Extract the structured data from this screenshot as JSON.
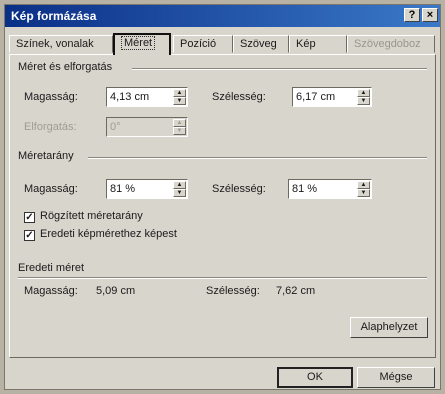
{
  "window": {
    "title": "Kép formázása",
    "help": "?",
    "close": "×"
  },
  "tabs": [
    {
      "label": "Színek, vonalak",
      "state": "normal"
    },
    {
      "label": "Méret",
      "state": "active"
    },
    {
      "label": "Pozíció",
      "state": "normal"
    },
    {
      "label": "Szöveg",
      "state": "normal"
    },
    {
      "label": "Kép",
      "state": "normal"
    },
    {
      "label": "Szövegdoboz",
      "state": "disabled"
    }
  ],
  "size_rotate": {
    "title": "Méret és elforgatás",
    "height_label": "Magasság:",
    "height_value": "4,13 cm",
    "width_label": "Szélesség:",
    "width_value": "6,17 cm",
    "rotation_label": "Elforgatás:",
    "rotation_value": "0°"
  },
  "scale": {
    "title": "Méretarány",
    "height_label": "Magasság:",
    "height_value": "81 %",
    "width_label": "Szélesség:",
    "width_value": "81 %",
    "lock_aspect": {
      "label": "Rögzített méretarány",
      "checked": true
    },
    "relative_original": {
      "label": "Eredeti képmérethez képest",
      "checked": true
    }
  },
  "original": {
    "title": "Eredeti méret",
    "height_label": "Magasság:",
    "height_value": "5,09 cm",
    "width_label": "Szélesség:",
    "width_value": "7,62 cm",
    "reset_button": "Alaphelyzet"
  },
  "footer": {
    "ok": "OK",
    "cancel": "Mégse"
  },
  "icons": {
    "spin_up": "▲",
    "spin_down": "▼",
    "check": "✓"
  }
}
